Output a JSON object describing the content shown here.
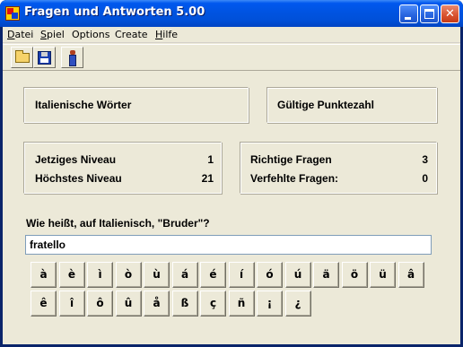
{
  "window": {
    "title": "Fragen und Antworten 5.00"
  },
  "menu": [
    {
      "pre": "",
      "u": "D",
      "post": "atei"
    },
    {
      "pre": "",
      "u": "S",
      "post": "piel"
    },
    {
      "pre": "Options",
      "u": "",
      "post": ""
    },
    {
      "pre": "Create",
      "u": "",
      "post": ""
    },
    {
      "pre": "",
      "u": "H",
      "post": "ilfe"
    }
  ],
  "toolbar": {
    "buttons": [
      "open-folder-icon",
      "save-disk-icon",
      "person-icon"
    ]
  },
  "topic": "Italienische Wörter",
  "valid_score_label": "Gültige Punktezahl",
  "levels": {
    "current_label": "Jetziges Niveau",
    "current_value": "1",
    "max_label": "Höchstes Niveau",
    "max_value": "21"
  },
  "stats": {
    "correct_label": "Richtige Fragen",
    "correct_value": "3",
    "failed_label": "Verfehlte Fragen:",
    "failed_value": "0"
  },
  "question": "Wie heißt, auf Italienisch, \"Bruder\"?",
  "answer": "fratello",
  "chars_row1": [
    "à",
    "è",
    "ì",
    "ò",
    "ù",
    "á",
    "é",
    "í",
    "ó",
    "ú",
    "ä",
    "ö",
    "ü",
    "â"
  ],
  "chars_row2": [
    "ê",
    "î",
    "ô",
    "û",
    "å",
    "ß",
    "ç",
    "ñ",
    "¡",
    "¿"
  ]
}
